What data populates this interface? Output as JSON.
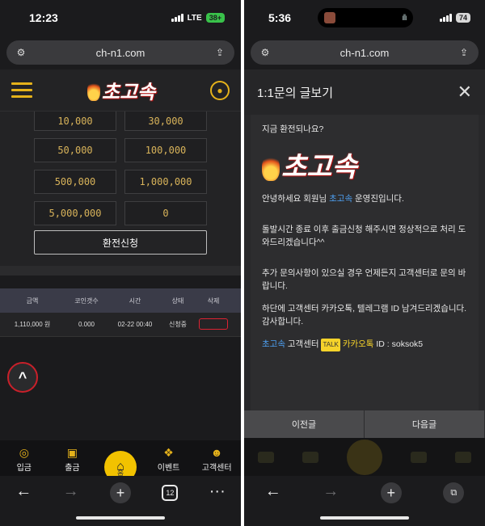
{
  "left": {
    "status": {
      "time": "12:23",
      "network": "LTE",
      "battery": "38+"
    },
    "url": "ch-n1.com",
    "logo_text": "초고속",
    "amounts": [
      [
        "10,000",
        "30,000"
      ],
      [
        "50,000",
        "100,000"
      ],
      [
        "500,000",
        "1,000,000"
      ],
      [
        "5,000,000",
        "0"
      ]
    ],
    "apply_label": "환전신청",
    "table": {
      "headers": [
        "금액",
        "코인갯수",
        "시간",
        "상태",
        "삭제"
      ],
      "row": {
        "amount": "1,110,000 원",
        "coins": "0.000",
        "time": "02-22 00:40",
        "status": "신청중"
      }
    },
    "nav": {
      "deposit": "입금",
      "withdraw": "출금",
      "home": "홈",
      "event": "이벤트",
      "support": "고객센터"
    },
    "toolbar": {
      "tabs_count": "12"
    }
  },
  "right": {
    "status": {
      "time": "5:36",
      "battery": "74"
    },
    "url": "ch-n1.com",
    "modal_title": "1:1문의 글보기",
    "question": "지금 환전되나요?",
    "logo_text": "초고속",
    "greeting_pre": "안녕하세요 회원님 ",
    "greeting_accent": "초고속",
    "greeting_post": " 운영진입니다.",
    "para1": "돌발시간 종료 이후 출금신청 해주시면 정상적으로 처리 도와드리겠습니다^^",
    "para2": "추가 문의사항이 있으실 경우 언제든지 고객센터로 문의 바랍니다.",
    "para3": "하단에 고객센터 카카오톡, 텔레그램 ID 남겨드리겠습니다. 감사합니다.",
    "footer_accent": "초고속",
    "footer_support": " 고객센터 ",
    "footer_kakao_badge": "TALK",
    "footer_kakao": "카카오톡",
    "footer_id": " ID : soksok5",
    "prev_label": "이전글",
    "next_label": "다음글"
  },
  "colors": {
    "accent_gold": "#e5b21b",
    "link_blue": "#4ea2f5",
    "danger_red": "#c9202a",
    "home_yellow": "#f2c200"
  }
}
